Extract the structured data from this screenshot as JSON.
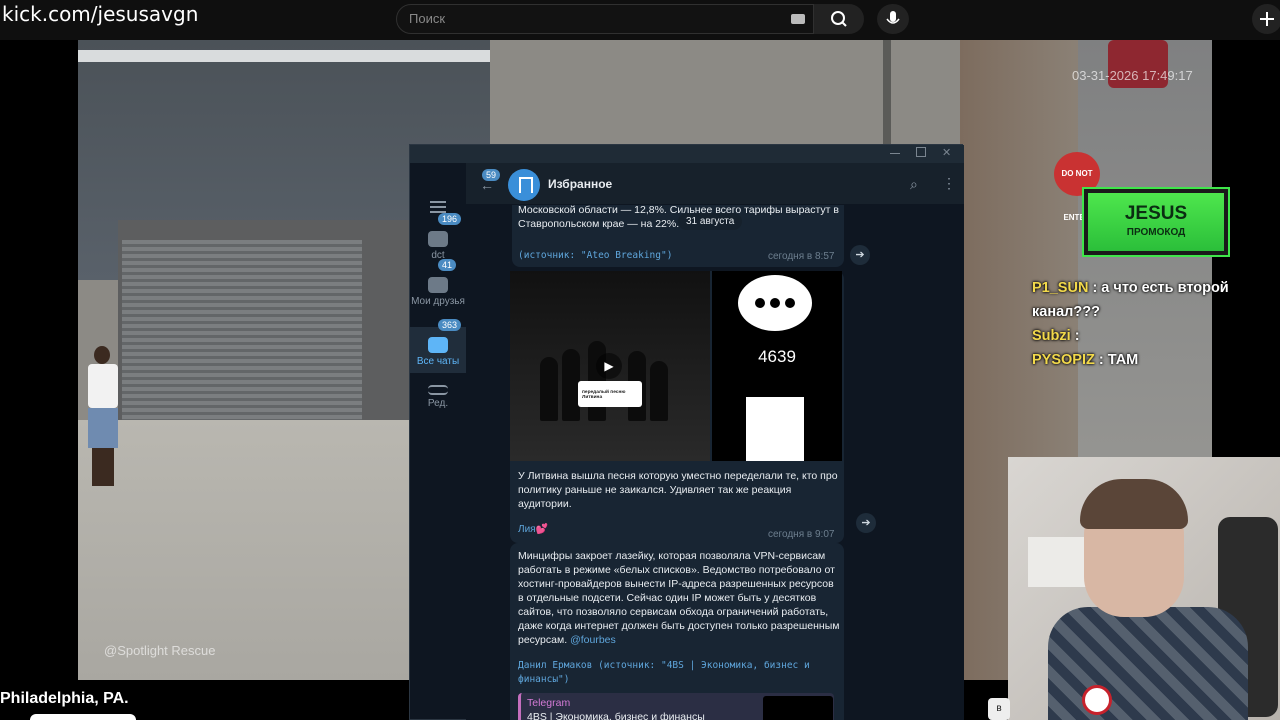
{
  "browser": {
    "url": "kick.com/jesusavgn",
    "search_placeholder": "Поиск"
  },
  "stream": {
    "camera_timestamp": "03-31-2026 17:49:17",
    "watermark": "@Spotlight Rescue",
    "location": "Philadelphia, PA.",
    "stop_sign": "DO NOT ENTER"
  },
  "telegram": {
    "chat_title": "Избранное",
    "back_badge": "59",
    "rail": [
      {
        "label": "dct",
        "badge": "196"
      },
      {
        "label": "Мои друзья",
        "badge": "41"
      },
      {
        "label": "Все чаты",
        "badge": "363"
      },
      {
        "label": "Ред.",
        "badge": ""
      }
    ],
    "date_pill": "31 августа",
    "messages": [
      {
        "text_line1": "Московской области — 12,8%. Сильнее всего тарифы вырастут в",
        "text_line2": "Ставропольском крае — на 22%.",
        "source": "(источник: \"Ateo Breaking\")",
        "time": "сегодня в 8:57"
      },
      {
        "media_card": "передалый песню Литвина",
        "view_count": "4639",
        "text": "У Литвина вышла песня которую уместно переделали те, кто про политику раньше не заикался. Удивляет так же реакция аудитории.",
        "author": "Лия💕",
        "time": "сегодня в 9:07"
      },
      {
        "text": "Минцифры закроет лазейку, которая позволяла VPN-сервисам работать в режиме «белых списков». Ведомство потребовало от хостинг-провайдеров вынести IP-адреса разрешенных ресурсов в отдельные подсети. Сейчас один IP может быть у десятков сайтов, что позволяло сервисам обхода ограничений работать, даже когда интернет должен быть доступен только разрешенным ресурсам.",
        "link": "@fourbes",
        "source": "Данил Ермаков (источник: \"4BS | Экономика, бизнес и финансы\")",
        "preview_title": "Telegram",
        "preview_sub": "4BS | Экономика, бизнес и финансы"
      }
    ]
  },
  "overlay": {
    "promo_title": "JESUS",
    "promo_sub": "ПРОМОКОД",
    "chat": [
      {
        "user": "P1_SUN",
        "user_color": "#f2d94b",
        "text": ": а что есть второй канал???"
      },
      {
        "user": "Subzi",
        "user_color": "#f2d94b",
        "text": ":"
      },
      {
        "user": "PYSOPIZ",
        "user_color": "#f2d94b",
        "text": ": ТАМ"
      }
    ]
  },
  "colors": {
    "telegram_bg": "#17212b",
    "telegram_accent": "#5eb5f7",
    "promo_green": "#3fe54a"
  }
}
